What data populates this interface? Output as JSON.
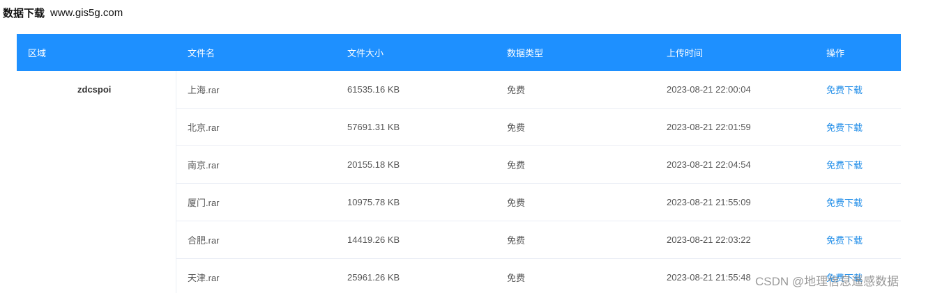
{
  "header": {
    "title": "数据下载",
    "site": "www.gis5g.com"
  },
  "table": {
    "columns": [
      "区域",
      "文件名",
      "文件大小",
      "数据类型",
      "上传时间",
      "操作"
    ],
    "region": "zdcspoi",
    "rows": [
      {
        "name": "上海.rar",
        "size": "61535.16 KB",
        "type": "免费",
        "time": "2023-08-21 22:00:04",
        "action": "免费下载"
      },
      {
        "name": "北京.rar",
        "size": "57691.31 KB",
        "type": "免费",
        "time": "2023-08-21 22:01:59",
        "action": "免费下载"
      },
      {
        "name": "南京.rar",
        "size": "20155.18 KB",
        "type": "免费",
        "time": "2023-08-21 22:04:54",
        "action": "免费下载"
      },
      {
        "name": "厦门.rar",
        "size": "10975.78 KB",
        "type": "免费",
        "time": "2023-08-21 21:55:09",
        "action": "免费下载"
      },
      {
        "name": "合肥.rar",
        "size": "14419.26 KB",
        "type": "免费",
        "time": "2023-08-21 22:03:22",
        "action": "免费下载"
      },
      {
        "name": "天津.rar",
        "size": "25961.26 KB",
        "type": "免费",
        "time": "2023-08-21 21:55:48",
        "action": "免费下载"
      }
    ]
  },
  "watermark": "CSDN @地理信息遥感数据",
  "colors": {
    "header_bg": "#1e90ff",
    "link": "#1e8ce8"
  }
}
